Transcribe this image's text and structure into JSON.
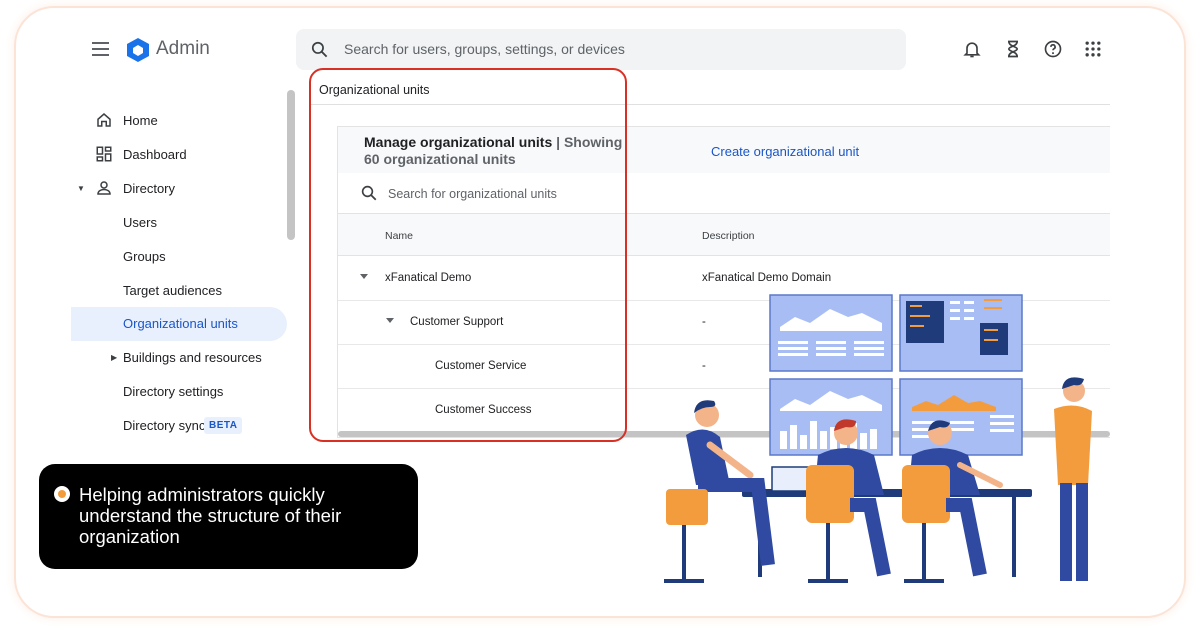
{
  "header": {
    "brand": "Admin",
    "search_placeholder": "Search for users, groups, settings, or devices"
  },
  "sidebar": {
    "items": [
      {
        "label": "Home"
      },
      {
        "label": "Dashboard"
      },
      {
        "label": "Directory"
      },
      {
        "label": "Users"
      },
      {
        "label": "Groups"
      },
      {
        "label": "Target audiences"
      },
      {
        "label": "Organizational units"
      },
      {
        "label": "Buildings and resources"
      },
      {
        "label": "Directory settings"
      },
      {
        "label": "Directory sync",
        "badge": "BETA"
      }
    ]
  },
  "main": {
    "page_title": "Organizational units",
    "card_title": "Manage organizational units",
    "card_subtitle": "| Showing 60 organizational units",
    "create_link": "Create organizational unit",
    "search_placeholder": "Search for organizational units",
    "columns": [
      "Name",
      "Description"
    ],
    "rows": [
      {
        "name": "xFanatical Demo",
        "description": "xFanatical Demo Domain"
      },
      {
        "name": "Customer Support",
        "description": "-"
      },
      {
        "name": "Customer Service",
        "description": "-"
      },
      {
        "name": "Customer Success",
        "description": ""
      }
    ]
  },
  "callout": {
    "text": "Helping administrators quickly understand the structure of their organization"
  },
  "colors": {
    "accent": "#1a56c6",
    "highlight": "#d93025",
    "callout_dot": "#f39c3d"
  }
}
